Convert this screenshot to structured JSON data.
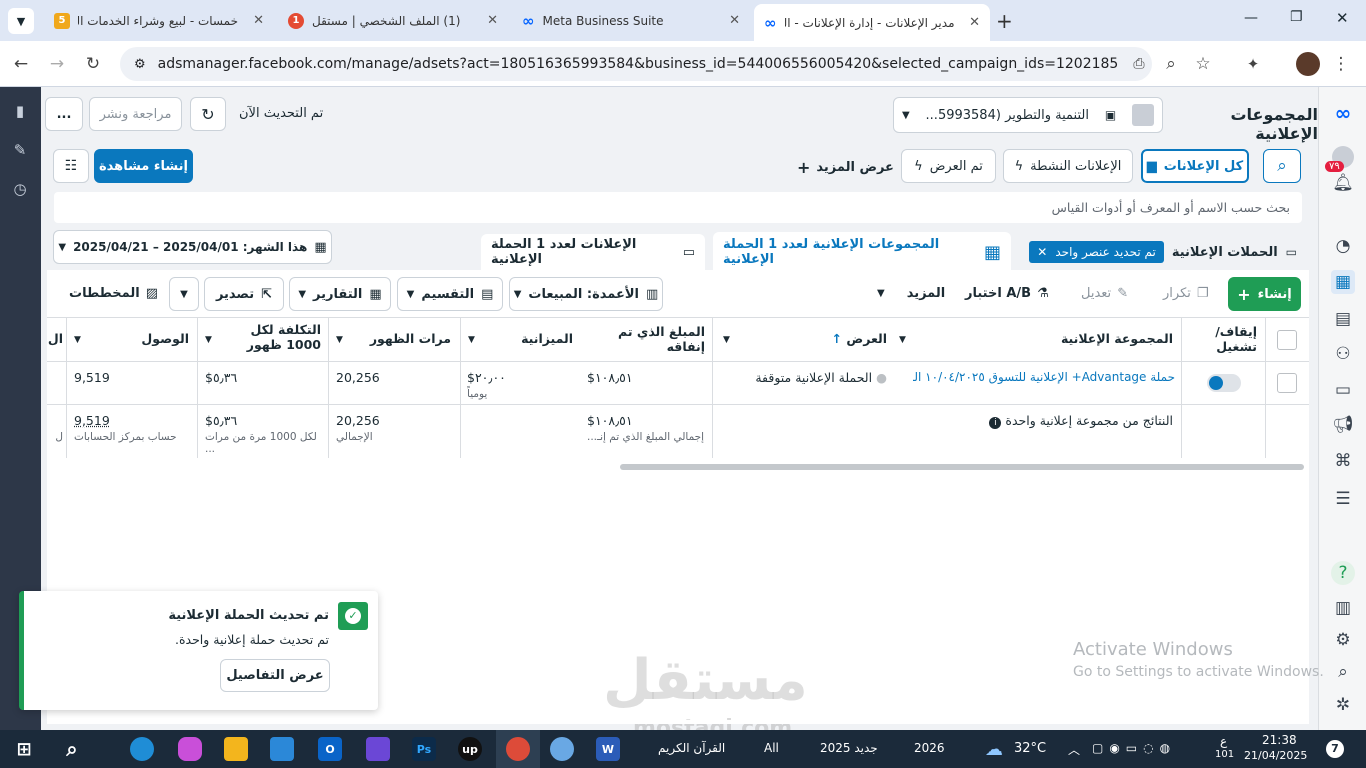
{
  "browser": {
    "tabs": [
      {
        "title": "خمسات - لبيع وشراء الخدمات المـ",
        "badge": "5",
        "color": "#f0a81c"
      },
      {
        "title": "(1) الملف الشخصي | مستقل",
        "badge": "1",
        "color": "#e44b33"
      },
      {
        "title": "Meta Business Suite",
        "badge": "∞",
        "color": "#0866ff"
      },
      {
        "title": "مدير الإعلانات - إدارة الإعلانات - الـ",
        "badge": "∞",
        "color": "#0866ff"
      }
    ],
    "new_tab": "+",
    "url": "adsmanager.facebook.com/manage/adsets?act=180516365993584&business_id=544006556005420&selected_campaign_ids=120218575964..."
  },
  "header": {
    "page_title": "المجموعات الإعلانية",
    "account_name": "التنمية والتطوير (5993584...",
    "updated_text": "تم التحديث الآن",
    "review_publish": "مراجعة ونشر",
    "more": "..."
  },
  "toolbar1": {
    "all_ads": "كل الإعلانات",
    "active_ads": "الإعلانات النشطة",
    "delivered": "تم العرض",
    "show_more": "عرض المزيد",
    "create_view": "إنشاء مشاهدة"
  },
  "search": {
    "placeholder": "بحث حسب الاسم أو المعرف أو أدوات القياس"
  },
  "level_tabs": {
    "campaigns": "الحملات الإعلانية",
    "selected_chip": "تم تحديد عنصر واحد",
    "adsets": "المجموعات الإعلانية لعدد 1 الحملة الإعلانية",
    "ads": "الإعلانات لعدد 1 الحملة الإعلانية",
    "date_range": "هذا الشهر: 2025/04/01 – 2025/04/21"
  },
  "toolbar2": {
    "create": "إنشاء",
    "duplicate": "تكرار",
    "edit": "تعديل",
    "ab_test": "اختبار A/B",
    "more": "المزيد",
    "columns": "الأعمدة: المبيعات",
    "breakdown": "التقسيم",
    "reports": "التقارير",
    "export": "تصدير",
    "charts": "المخططات"
  },
  "table": {
    "headers": {
      "toggle": "إيقاف/ تشغيل",
      "adset": "المجموعة الإعلانية",
      "delivery": "العرض",
      "spent": "المبلغ الذي تم إنفاقه",
      "budget": "الميزانية",
      "impressions": "مرات الظهور",
      "cpm": "التكلفة لكل 1000 ظهور",
      "reach": "الوصول",
      "cut": "ال"
    },
    "row": {
      "adset": "حملة Advantage+ الإعلانية للتسوق ١٠/٠٤/٢٠٢٥ المـ...",
      "delivery": "الحملة الإعلانية متوقفة",
      "spent": "$١٠٨٫٥١",
      "budget": "$٢٠٫٠٠",
      "budget_sub": "يومياً",
      "impressions": "20,256",
      "cpm": "$٥٫٣٦",
      "reach": "9,519"
    },
    "summary": {
      "label": "النتائج من مجموعة إعلانية واحدة",
      "spent": "$١٠٨٫٥١",
      "spent_sub": "إجمالي المبلغ الذي تم إنـ...",
      "impressions": "20,256",
      "impressions_sub": "الإجمالي",
      "cpm": "$٥٫٣٦",
      "cpm_sub": "لكل 1000 مرة من مرات ...",
      "reach": "9,519",
      "reach_sub": "حساب بمركز الحسابات",
      "cut_sub": "ل"
    }
  },
  "toast": {
    "title": "تم تحديث الحملة الإعلانية",
    "body": "تم تحديث حملة إعلانية واحدة.",
    "details": "عرض التفاصيل"
  },
  "watermark": {
    "line1": "Activate Windows",
    "line2": "Go to Settings to activate Windows.",
    "brand": "مستقل",
    "brand_url": "mostaql.com"
  },
  "sidebar": {
    "notif_count": "٧٩"
  },
  "taskbar": {
    "quran": "القرآن الكريم",
    "all": "All",
    "new2025": "جديد 2025",
    "y2026": "2026",
    "temp": "32°C",
    "lang": "ع",
    "time": "21:38",
    "date": "21/04/2025",
    "lang_sub": "101",
    "notif": "7"
  }
}
